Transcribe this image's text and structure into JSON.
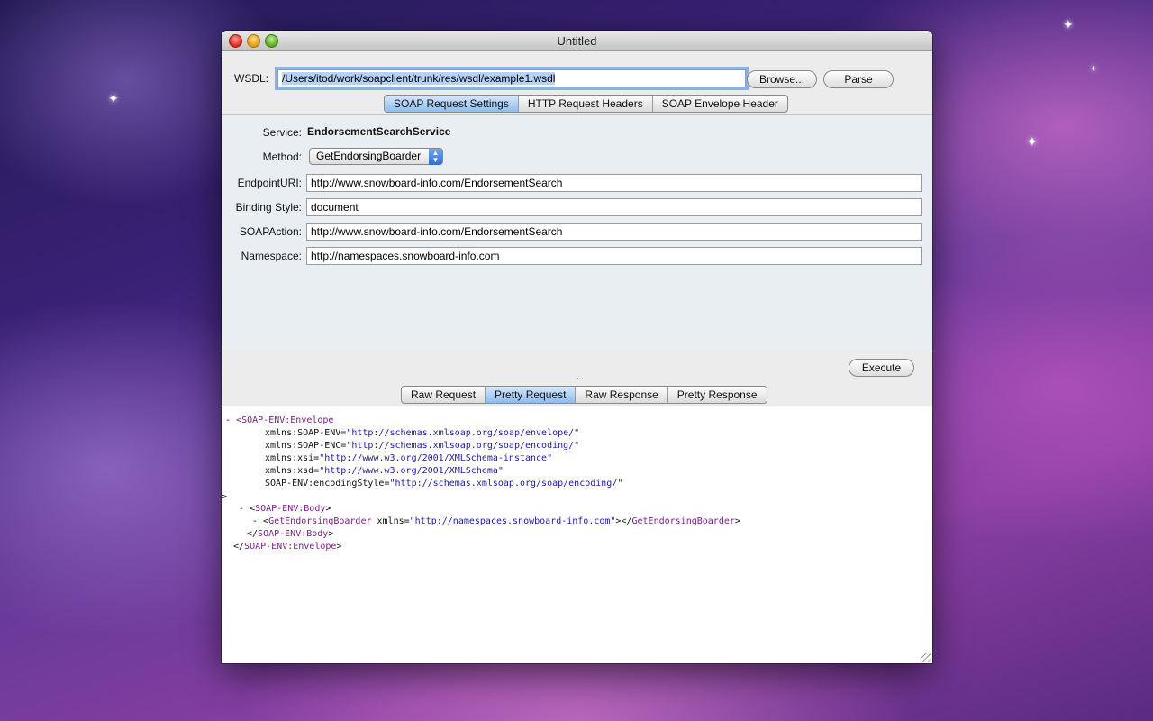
{
  "window": {
    "title": "Untitled"
  },
  "wsdl": {
    "label": "WSDL:",
    "value": "/Users/itod/work/soapclient/trunk/res/wsdl/example1.wsdl",
    "browse_label": "Browse...",
    "parse_label": "Parse"
  },
  "settings_tabs": [
    {
      "label": "SOAP Request Settings",
      "active": true
    },
    {
      "label": "HTTP Request Headers",
      "active": false
    },
    {
      "label": "SOAP Envelope Header",
      "active": false
    }
  ],
  "settings": {
    "service_label": "Service:",
    "service_value": "EndorsementSearchService",
    "method_label": "Method:",
    "method_value": "GetEndorsingBoarder",
    "endpoint_label": "EndpointURI:",
    "endpoint_value": "http://www.snowboard-info.com/EndorsementSearch",
    "binding_label": "Binding Style:",
    "binding_value": "document",
    "soapaction_label": "SOAPAction:",
    "soapaction_value": "http://www.snowboard-info.com/EndorsementSearch",
    "namespace_label": "Namespace:",
    "namespace_value": "http://namespaces.snowboard-info.com"
  },
  "execute_label": "Execute",
  "output_tabs": [
    {
      "label": "Raw Request",
      "active": false
    },
    {
      "label": "Pretty Request",
      "active": true
    },
    {
      "label": "Raw Response",
      "active": false
    },
    {
      "label": "Pretty Response",
      "active": false
    }
  ],
  "xml": {
    "l1_dash": "-",
    "l1_open": "<",
    "l1_tag": "SOAP-ENV:Envelope",
    "l2_attr": "xmlns:SOAP-ENV=",
    "l2_val": "\"http://schemas.xmlsoap.org/soap/envelope/\"",
    "l3_attr": "xmlns:SOAP-ENC=",
    "l3_val": "\"http://schemas.xmlsoap.org/soap/encoding/\"",
    "l4_attr": "xmlns:xsi=",
    "l4_val": "\"http://www.w3.org/2001/XMLSchema-instance\"",
    "l5_attr": "xmlns:xsd=",
    "l5_val": "\"http://www.w3.org/2001/XMLSchema\"",
    "l6_attr": "SOAP-ENV:encodingStyle=",
    "l6_val": "\"http://schemas.xmlsoap.org/soap/encoding/\"",
    "l7": ">",
    "l8_dash": "-",
    "l8_open": "<",
    "l8_tag": "SOAP-ENV:Body",
    "l8_close": ">",
    "l9_dash": "-",
    "l9_open": "<",
    "l9_tag": "GetEndorsingBoarder",
    "l9_attr": " xmlns=",
    "l9_val": "\"http://namespaces.snowboard-info.com\"",
    "l9_mid": "></",
    "l9_endtag": "GetEndorsingBoarder",
    "l9_close": ">",
    "l10_open": "</",
    "l10_tag": "SOAP-ENV:Body",
    "l10_close": ">",
    "l11_open": "</",
    "l11_tag": "SOAP-ENV:Envelope",
    "l11_close": ">"
  }
}
